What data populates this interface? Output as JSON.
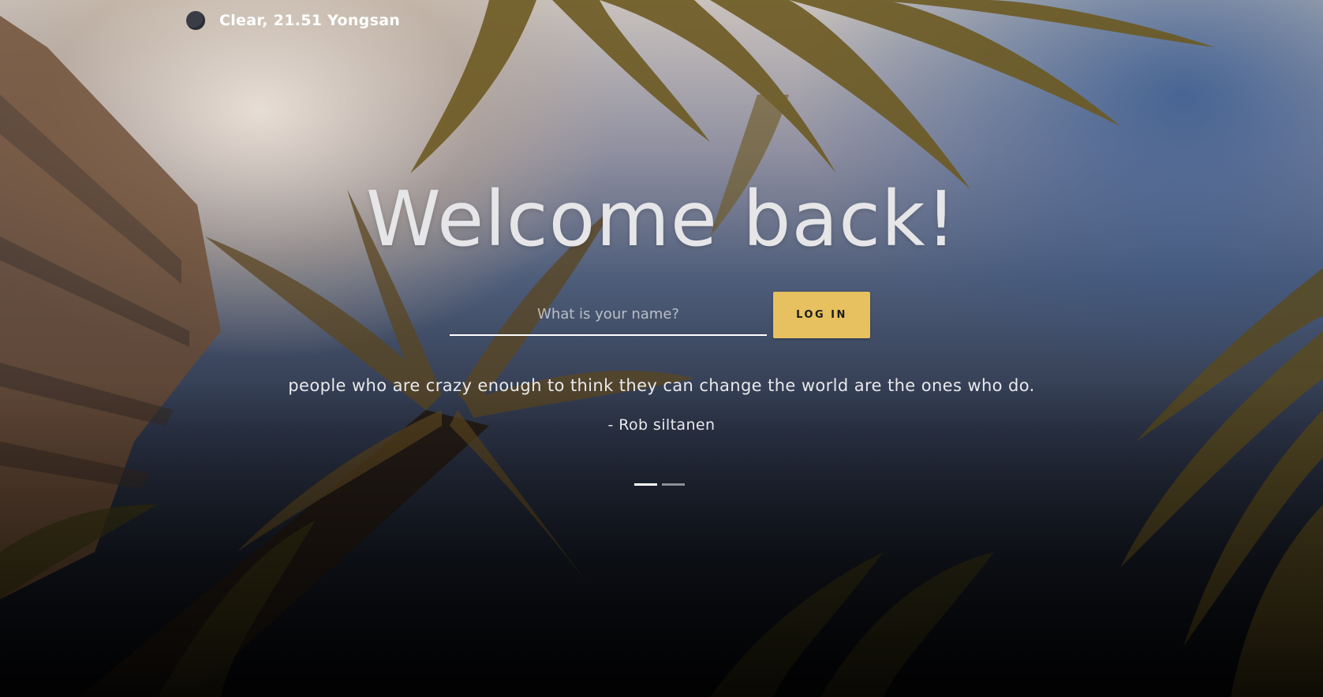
{
  "weather": {
    "icon": "moon-icon",
    "text": "Clear, 21.51 Yongsan"
  },
  "greeting": "Welcome back!",
  "login": {
    "placeholder": "What is your name?",
    "value": "",
    "button_label": "LOG IN"
  },
  "quote": {
    "text": "people who are crazy enough to think they can change the world are the ones who do.",
    "author": "- Rob siltanen"
  },
  "slider": {
    "count": 2,
    "active_index": 0
  },
  "colors": {
    "accent": "#e7c15f",
    "text": "#ffffff"
  }
}
